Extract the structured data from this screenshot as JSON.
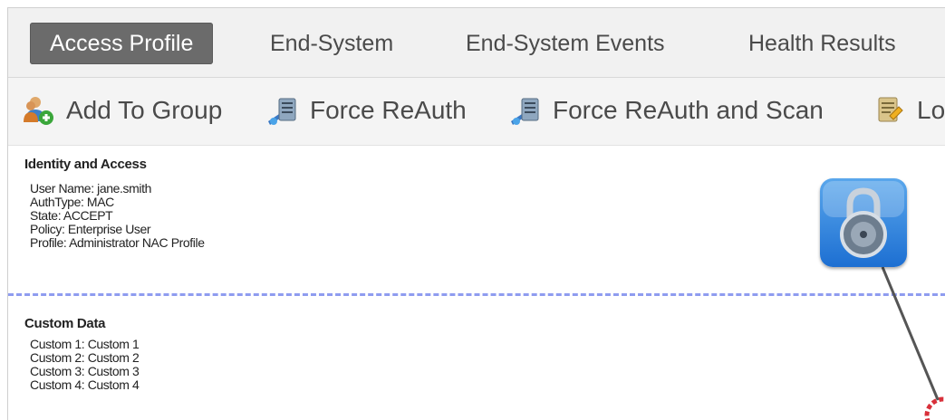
{
  "tabs": [
    {
      "label": "Access Profile",
      "active": true
    },
    {
      "label": "End-System",
      "active": false
    },
    {
      "label": "End-System Events",
      "active": false
    },
    {
      "label": "Health Results",
      "active": false
    }
  ],
  "toolbar": {
    "add_to_group": "Add To Group",
    "force_reauth": "Force ReAuth",
    "force_reauth_scan": "Force ReAuth and Scan",
    "partial": "Lo"
  },
  "identity": {
    "title": "Identity and Access",
    "user_name": "User Name: jane.smith",
    "auth_type": "AuthType: MAC",
    "state": "State: ACCEPT",
    "policy": "Policy: Enterprise User",
    "profile": "Profile: Administrator NAC Profile"
  },
  "custom": {
    "title": "Custom Data",
    "c1": "Custom 1: Custom 1",
    "c2": "Custom 2: Custom 2",
    "c3": "Custom 3: Custom 3",
    "c4": "Custom 4: Custom 4"
  },
  "icons": {
    "add_to_group": "users-add-icon",
    "force_reauth": "server-network-icon",
    "force_reauth_scan": "server-network-icon",
    "partial": "log-icon",
    "lock": "padlock-icon",
    "node": "network-node-icon"
  },
  "colors": {
    "active_tab_bg": "#6b6b6b",
    "divider": "#8f9cf0",
    "lock_gradient_top": "#5aa7ec",
    "lock_gradient_bottom": "#1d6fd2"
  }
}
